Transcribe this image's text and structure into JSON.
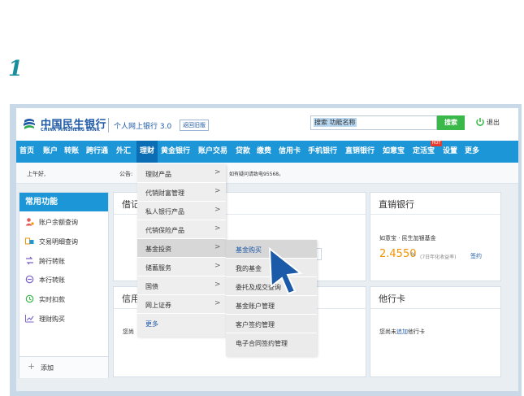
{
  "step_number": "1",
  "header": {
    "logo_cn": "中国民生银行",
    "logo_en": "CHINA MINSHENG BANK",
    "product_version": "个人网上银行 3.0",
    "old_version_link": "返回旧版",
    "search_placeholder": "搜索 功能名称",
    "search_button": "搜索",
    "logout": "退出",
    "icons": {
      "logo": "minsheng-logo-icon",
      "power": "power-icon"
    }
  },
  "nav": {
    "items": [
      "首页",
      "账户",
      "转账",
      "跨行通",
      "外汇",
      "理财",
      "黄金银行",
      "账户交易",
      "贷款",
      "缴费",
      "信用卡",
      "手机银行",
      "直销银行",
      "如意宝",
      "定活宝",
      "设置",
      "更多"
    ],
    "active": "理财",
    "hot_badge": "HOT"
  },
  "announcement": {
    "greeting": "上午好,",
    "label": "公告:",
    "tail": "如有疑问请致电95568。"
  },
  "sidebar": {
    "title": "常用功能",
    "items": [
      {
        "label": "账户余额查询",
        "icon": "user-balance-icon"
      },
      {
        "label": "交易明细查询",
        "icon": "transaction-detail-icon"
      },
      {
        "label": "跨行转账",
        "icon": "cross-bank-transfer-icon"
      },
      {
        "label": "本行转账",
        "icon": "same-bank-transfer-icon"
      },
      {
        "label": "实时扣款",
        "icon": "realtime-debit-icon"
      },
      {
        "label": "理财购买",
        "icon": "wealth-chart-icon"
      }
    ],
    "add_label": "添加"
  },
  "panels": {
    "left_top_title_partial": "借记",
    "left_bottom_title_partial": "信用",
    "left_bottom_text_partial": "您尚",
    "direct_bank": {
      "title": "直销银行",
      "fund_name": "如意宝 · 民生加银基金",
      "rate": "2.4550",
      "rate_unit": "%",
      "rate_note": "(7日年化收益率)",
      "sign_link": "签约"
    },
    "other_card": {
      "title": "他行卡",
      "text_before": "您尚未",
      "link": "追加",
      "text_after": "他行卡"
    }
  },
  "menu_level1": {
    "items": [
      {
        "label": "理财产品",
        "arrow": ">"
      },
      {
        "label": "代销财富管理",
        "arrow": ">"
      },
      {
        "label": "私人银行产品",
        "arrow": ">"
      },
      {
        "label": "代销保险产品",
        "arrow": ">"
      },
      {
        "label": "基金投资",
        "arrow": ">"
      },
      {
        "label": "储蓄服务",
        "arrow": ">"
      },
      {
        "label": "国债",
        "arrow": ">"
      },
      {
        "label": "网上证券",
        "arrow": ">"
      },
      {
        "label": "更多",
        "arrow": ""
      }
    ],
    "selected": "基金投资"
  },
  "menu_level2": {
    "items": [
      "基金购买",
      "我的基金",
      "委托及成交查询",
      "基金账户管理",
      "客户签约管理",
      "电子合同签约管理"
    ],
    "selected": "基金购买"
  },
  "colors": {
    "nav_bg": "#1c96d6",
    "nav_active": "#0b6db4",
    "brand_blue": "#1f5aa6",
    "search_green": "#3bb84a",
    "rate_orange": "#f29400",
    "step_teal": "#1a8f9b",
    "hot_red": "#e83b2e"
  }
}
